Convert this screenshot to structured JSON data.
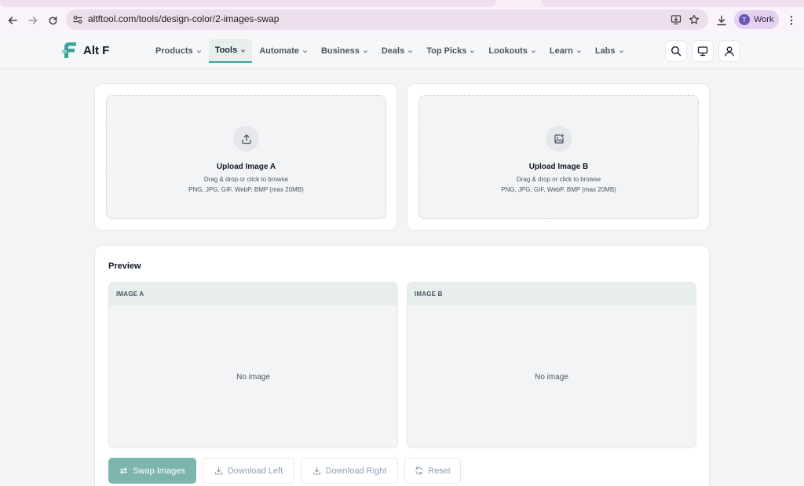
{
  "browser": {
    "url": "altftool.com/tools/design-color/2-images-swap",
    "profile_initial": "T",
    "profile_label": "Work"
  },
  "site": {
    "logo_text": "Alt F",
    "brand_color": "#3ba39a",
    "menu": [
      {
        "label": "Products",
        "active": false
      },
      {
        "label": "Tools",
        "active": true
      },
      {
        "label": "Automate",
        "active": false
      },
      {
        "label": "Business",
        "active": false
      },
      {
        "label": "Deals",
        "active": false
      },
      {
        "label": "Top Picks",
        "active": false
      },
      {
        "label": "Lookouts",
        "active": false
      },
      {
        "label": "Learn",
        "active": false
      },
      {
        "label": "Labs",
        "active": false
      }
    ]
  },
  "upload": {
    "a": {
      "title": "Upload Image A",
      "subtitle": "Drag & drop or click to browse",
      "formats": "PNG, JPG, GIF, WebP, BMP (max 20MB)",
      "icon": "upload-icon"
    },
    "b": {
      "title": "Upload Image B",
      "subtitle": "Drag & drop or click to browse",
      "formats": "PNG, JPG, GIF, WebP, BMP (max 20MB)",
      "icon": "image-plus-icon"
    }
  },
  "preview": {
    "title": "Preview",
    "pane_a": {
      "label": "IMAGE A",
      "empty": "No image"
    },
    "pane_b": {
      "label": "IMAGE B",
      "empty": "No image"
    }
  },
  "actions": {
    "swap": "Swap Images",
    "download_left": "Download Left",
    "download_right": "Download Right",
    "reset": "Reset"
  }
}
